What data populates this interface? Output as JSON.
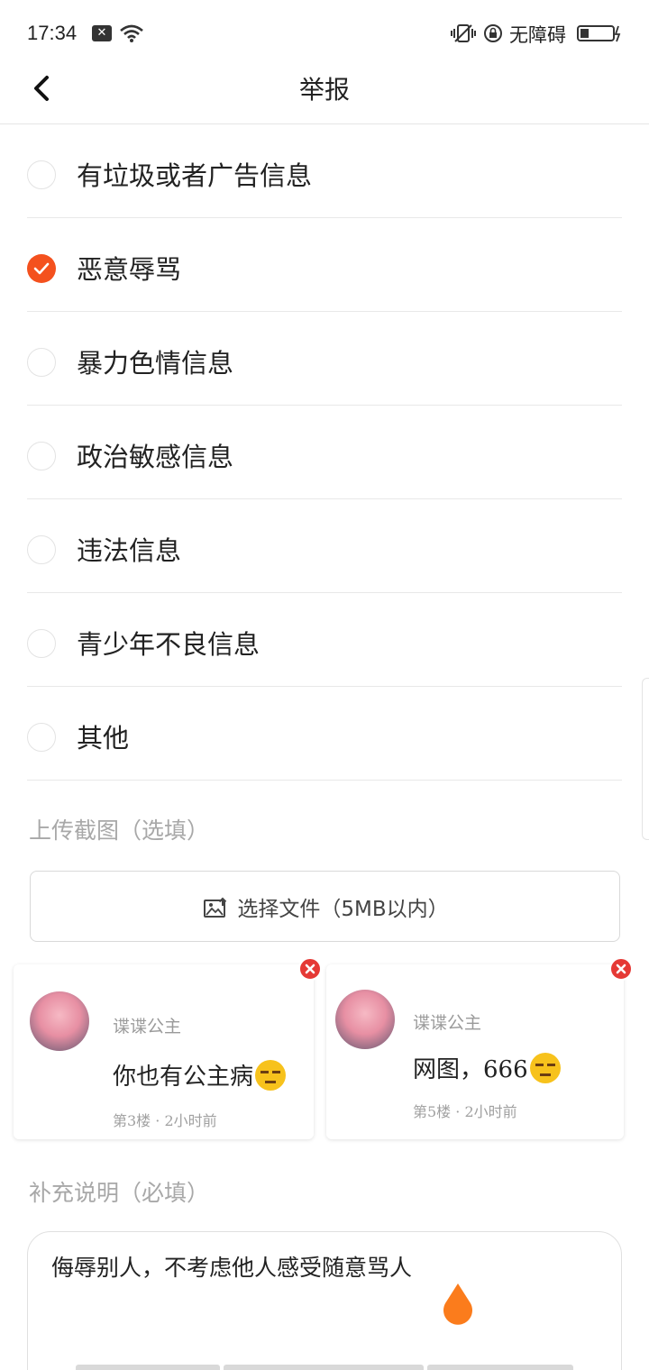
{
  "status_bar": {
    "time": "17:34",
    "notification": "✕",
    "accessibility_label": "无障碍"
  },
  "header": {
    "title": "举报"
  },
  "options": [
    {
      "label": "有垃圾或者广告信息",
      "checked": false
    },
    {
      "label": "恶意辱骂",
      "checked": true
    },
    {
      "label": "暴力色情信息",
      "checked": false
    },
    {
      "label": "政治敏感信息",
      "checked": false
    },
    {
      "label": "违法信息",
      "checked": false
    },
    {
      "label": "青少年不良信息",
      "checked": false
    },
    {
      "label": "其他",
      "checked": false
    }
  ],
  "upload": {
    "label": "上传截图（选填）",
    "button_label": "选择文件（5MB以内）"
  },
  "screenshots": [
    {
      "user": "谍谍公主",
      "text": "你也有公主病",
      "meta": "第3楼 · 2小时前"
    },
    {
      "user": "谍谍公主",
      "text": "网图，666",
      "meta": "第5楼 · 2小时前"
    }
  ],
  "description": {
    "label": "补充说明（必填）",
    "value": "侮辱别人，不考虑他人感受随意骂人"
  },
  "colors": {
    "accent": "#f4511e",
    "remove": "#e53935",
    "cursor_handle": "#fb7c1c"
  }
}
